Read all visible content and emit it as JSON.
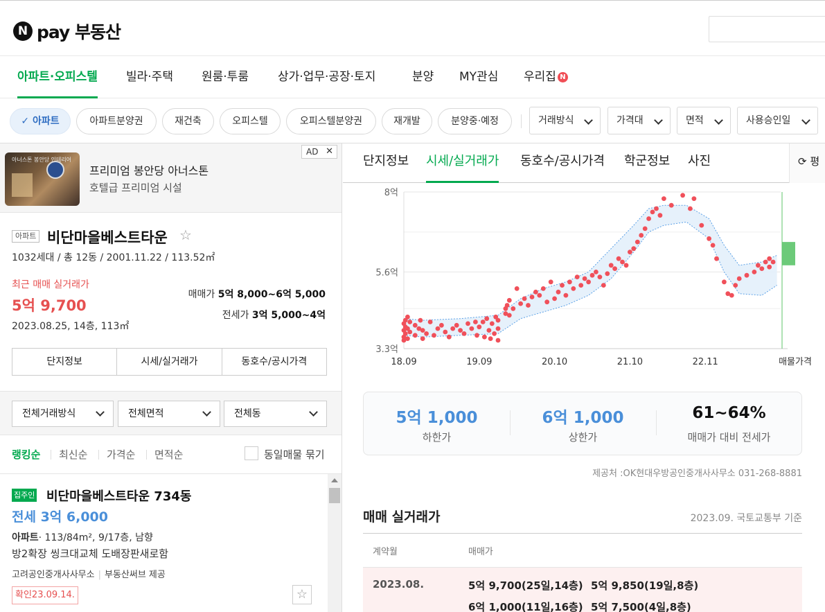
{
  "header": {
    "logo_letter": "N",
    "logo_text": "pay 부동산"
  },
  "nav": {
    "items": [
      {
        "label": "아파트·오피스텔",
        "active": true
      },
      {
        "label": "빌라·주택"
      },
      {
        "label": "원룸·투룸"
      },
      {
        "label": "상가·업무·공장·토지"
      },
      {
        "label": "분양"
      },
      {
        "label": "MY관심"
      },
      {
        "label": "우리집"
      }
    ],
    "badge": "N"
  },
  "filters": {
    "chips": [
      "아파트",
      "아파트분양권",
      "재건축",
      "오피스텔",
      "오피스텔분양권",
      "재개발",
      "분양중·예정"
    ],
    "check_mark": "✓",
    "dropdowns": [
      "거래방식",
      "가격대",
      "면적",
      "사용승인일"
    ]
  },
  "ad": {
    "title": "프리미엄 봉안당 아너스톤",
    "subtitle": "호텔급 프리미엄 시설",
    "tag": "AD",
    "close": "✕",
    "image_caption": "아너스톤 봉안당 인테리어"
  },
  "complex": {
    "kind": "아파트",
    "name": "비단마을베스트타운",
    "star": "☆",
    "info": "1032세대 / 총 12동 / 2001.11.22 / 113.52㎡",
    "recent_label": "최근 매매 실거래가",
    "recent_price": "5억 9,700",
    "recent_date": "2023.08.25, 14층, 113㎡",
    "sale_label": "매매가",
    "sale_range": "5억 8,000~6억 5,000",
    "jeonse_label": "전세가",
    "jeonse_range": "3억 5,000~4억",
    "tabs": [
      "단지정보",
      "시세/실거래가",
      "동호수/공시가격"
    ]
  },
  "list_filters": {
    "dropdowns": [
      "전체거래방식",
      "전체면적",
      "전체동"
    ],
    "sorts": [
      "랭킹순",
      "최신순",
      "가격순",
      "면적순"
    ],
    "group_label": "동일매물 묶기"
  },
  "listing": {
    "badge": "집주인",
    "name": "비단마을베스트타운 734동",
    "price": "전세 3억 6,000",
    "type": "아파트",
    "spec": "· 113/84m², 9/17층, 남향",
    "desc": "방2확장 씽크대교체 도배장판새로함",
    "agent": "고려공인중개사사무소",
    "source": "부동산써브 제공",
    "confirmed": "확인23.09.14.",
    "star": "☆"
  },
  "detail": {
    "tabs": [
      "단지정보",
      "시세/실거래가",
      "동호수/공시가격",
      "학군정보",
      "사진"
    ],
    "active_tab": 1,
    "refresh_icon": "⟳",
    "refresh_label": "평"
  },
  "chart_data": {
    "type": "scatter",
    "title": "",
    "x_ticks": [
      "18.09",
      "19.09",
      "20.10",
      "21.10",
      "22.11"
    ],
    "x_extra_label": "매물가격",
    "y_ticks": [
      "8억",
      "5.6억",
      "3.3억"
    ],
    "ylim": [
      3.3,
      8.0
    ],
    "y_unit": "억",
    "grid": true,
    "series": [
      {
        "kind": "deals",
        "color": "#f0505a",
        "points": [
          [
            2018.75,
            4.05
          ],
          [
            2018.75,
            3.85
          ],
          [
            2018.75,
            3.65
          ],
          [
            2018.75,
            3.55
          ],
          [
            2018.77,
            4.15
          ],
          [
            2018.77,
            3.95
          ],
          [
            2018.77,
            3.75
          ],
          [
            2018.8,
            4.25
          ],
          [
            2018.8,
            3.9
          ],
          [
            2018.8,
            3.6
          ],
          [
            2018.83,
            4.1
          ],
          [
            2018.83,
            3.8
          ],
          [
            2018.9,
            4.0
          ],
          [
            2018.9,
            3.7
          ],
          [
            2018.95,
            3.9
          ],
          [
            2018.97,
            4.15
          ],
          [
            2019.0,
            3.6
          ],
          [
            2019.0,
            3.85
          ],
          [
            2019.05,
            3.75
          ],
          [
            2019.1,
            4.1
          ],
          [
            2019.15,
            3.7
          ],
          [
            2019.2,
            3.9
          ],
          [
            2019.25,
            4.0
          ],
          [
            2019.3,
            3.8
          ],
          [
            2019.35,
            3.65
          ],
          [
            2019.4,
            3.9
          ],
          [
            2019.45,
            4.0
          ],
          [
            2019.5,
            3.85
          ],
          [
            2019.55,
            3.75
          ],
          [
            2019.6,
            4.05
          ],
          [
            2019.65,
            3.9
          ],
          [
            2019.7,
            4.1
          ],
          [
            2019.72,
            3.7
          ],
          [
            2019.75,
            3.95
          ],
          [
            2019.8,
            4.1
          ],
          [
            2019.82,
            3.65
          ],
          [
            2019.85,
            4.2
          ],
          [
            2019.88,
            3.85
          ],
          [
            2019.9,
            3.6
          ],
          [
            2019.92,
            4.05
          ],
          [
            2019.95,
            3.75
          ],
          [
            2019.97,
            4.25
          ],
          [
            2020.0,
            3.9
          ],
          [
            2020.0,
            3.55
          ],
          [
            2020.0,
            4.15
          ],
          [
            2020.1,
            4.5
          ],
          [
            2020.1,
            4.35
          ],
          [
            2020.12,
            4.6
          ],
          [
            2020.15,
            4.3
          ],
          [
            2020.15,
            4.75
          ],
          [
            2020.2,
            4.5
          ],
          [
            2020.25,
            5.1
          ],
          [
            2020.3,
            4.65
          ],
          [
            2020.35,
            4.8
          ],
          [
            2020.4,
            4.6
          ],
          [
            2020.45,
            4.85
          ],
          [
            2020.5,
            5.0
          ],
          [
            2020.55,
            4.9
          ],
          [
            2020.6,
            5.1
          ],
          [
            2020.65,
            4.7
          ],
          [
            2020.7,
            5.3
          ],
          [
            2020.75,
            4.8
          ],
          [
            2020.8,
            5.0
          ],
          [
            2020.85,
            5.2
          ],
          [
            2020.9,
            4.9
          ],
          [
            2020.95,
            5.3
          ],
          [
            2021.0,
            5.1
          ],
          [
            2021.05,
            5.45
          ],
          [
            2021.1,
            5.2
          ],
          [
            2021.15,
            5.4
          ],
          [
            2021.2,
            5.3
          ],
          [
            2021.25,
            5.5
          ],
          [
            2021.3,
            5.6
          ],
          [
            2021.35,
            5.45
          ],
          [
            2021.4,
            5.2
          ],
          [
            2021.45,
            5.55
          ],
          [
            2021.5,
            5.8
          ],
          [
            2021.55,
            5.7
          ],
          [
            2021.6,
            6.0
          ],
          [
            2021.65,
            5.9
          ],
          [
            2021.7,
            5.8
          ],
          [
            2021.75,
            6.2
          ],
          [
            2021.8,
            6.3
          ],
          [
            2021.85,
            6.5
          ],
          [
            2021.9,
            6.7
          ],
          [
            2021.95,
            6.9
          ],
          [
            2022.0,
            7.2
          ],
          [
            2022.05,
            7.4
          ],
          [
            2022.1,
            7.5
          ],
          [
            2022.15,
            7.3
          ],
          [
            2022.2,
            7.8
          ],
          [
            2022.3,
            7.6
          ],
          [
            2022.45,
            7.9
          ],
          [
            2022.55,
            7.5
          ],
          [
            2022.6,
            7.8
          ],
          [
            2022.7,
            7.0
          ],
          [
            2022.8,
            6.6
          ],
          [
            2022.85,
            6.4
          ],
          [
            2022.9,
            6.0
          ],
          [
            2023.0,
            5.3
          ],
          [
            2023.05,
            4.95
          ],
          [
            2023.1,
            4.9
          ],
          [
            2023.15,
            5.2
          ],
          [
            2023.2,
            5.4
          ],
          [
            2023.3,
            5.5
          ],
          [
            2023.4,
            5.6
          ],
          [
            2023.45,
            5.8
          ],
          [
            2023.5,
            5.7
          ],
          [
            2023.55,
            5.9
          ],
          [
            2023.6,
            5.75
          ],
          [
            2023.6,
            6.0
          ],
          [
            2023.65,
            5.9
          ]
        ]
      },
      {
        "kind": "market_upper",
        "color": "#5aa0e6",
        "points": [
          [
            2018.75,
            4.2
          ],
          [
            2019.0,
            4.15
          ],
          [
            2019.5,
            4.2
          ],
          [
            2020.0,
            4.3
          ],
          [
            2020.3,
            4.8
          ],
          [
            2020.6,
            5.1
          ],
          [
            2020.9,
            5.3
          ],
          [
            2021.2,
            5.6
          ],
          [
            2021.5,
            6.3
          ],
          [
            2021.8,
            7.0
          ],
          [
            2022.0,
            7.5
          ],
          [
            2022.2,
            7.6
          ],
          [
            2022.5,
            7.6
          ],
          [
            2022.8,
            7.2
          ],
          [
            2023.0,
            6.4
          ],
          [
            2023.2,
            5.8
          ],
          [
            2023.5,
            5.9
          ],
          [
            2023.7,
            6.1
          ]
        ]
      },
      {
        "kind": "market_lower",
        "color": "#5aa0e6",
        "points": [
          [
            2018.75,
            3.7
          ],
          [
            2019.0,
            3.65
          ],
          [
            2019.5,
            3.7
          ],
          [
            2020.0,
            3.75
          ],
          [
            2020.3,
            4.2
          ],
          [
            2020.6,
            4.4
          ],
          [
            2020.9,
            4.6
          ],
          [
            2021.2,
            4.9
          ],
          [
            2021.5,
            5.4
          ],
          [
            2021.8,
            6.2
          ],
          [
            2022.0,
            6.8
          ],
          [
            2022.2,
            7.0
          ],
          [
            2022.5,
            7.1
          ],
          [
            2022.8,
            6.6
          ],
          [
            2023.0,
            5.6
          ],
          [
            2023.2,
            4.95
          ],
          [
            2023.5,
            4.9
          ],
          [
            2023.7,
            5.2
          ]
        ]
      },
      {
        "kind": "listing_range",
        "color": "#5cc46a",
        "low": 5.8,
        "high": 6.5
      }
    ]
  },
  "stats": [
    {
      "value": "5억 1,000",
      "label": "하한가",
      "color": "#4a8fd9"
    },
    {
      "value": "6억 1,000",
      "label": "상한가",
      "color": "#4a8fd9"
    },
    {
      "value": "61~64%",
      "label": "매매가 대비 전세가",
      "color": "#111111"
    }
  ],
  "provider": "제공처 :OK현대우방공인중개사사무소 031-268-8881",
  "deals": {
    "title": "매매 실거래가",
    "basis": "2023.09. 국토교통부 기준",
    "headers": [
      "계약월",
      "매매가"
    ],
    "rows": [
      {
        "month": "2023.08.",
        "entries": [
          "5억 9,700(25일,14층)",
          "5억 9,850(19일,8층)",
          "6억 1,000(11일,16층)",
          "5억 7,500(4일,8층)"
        ]
      }
    ]
  }
}
